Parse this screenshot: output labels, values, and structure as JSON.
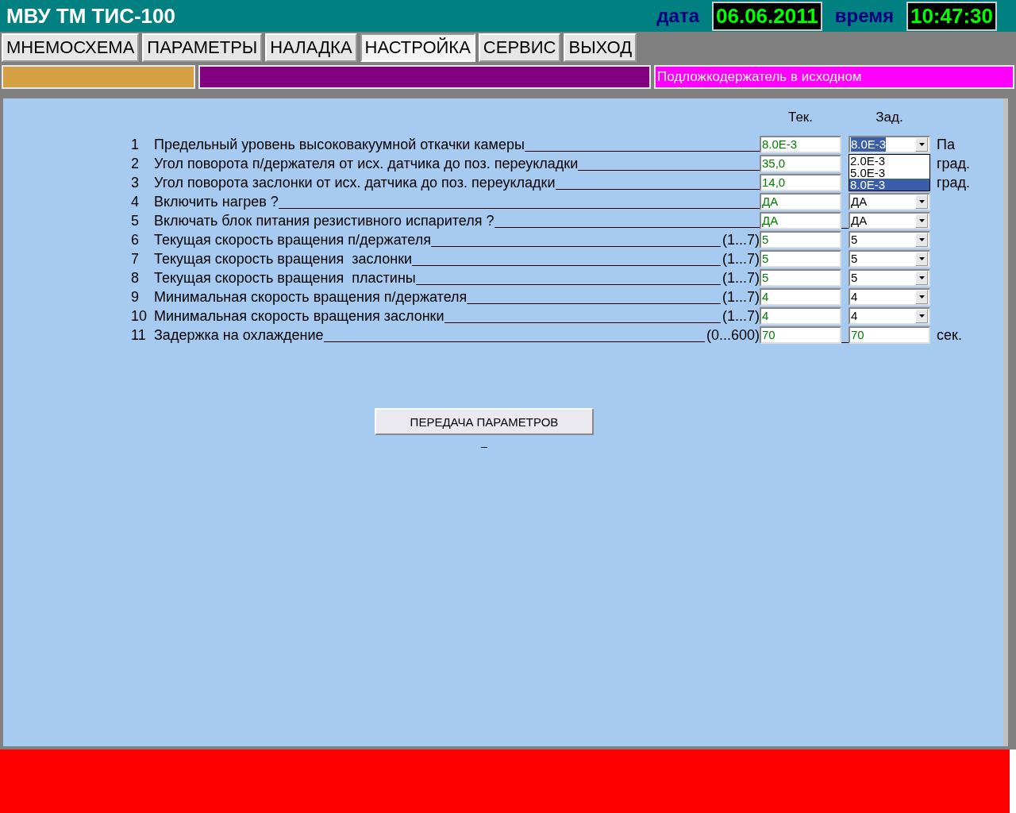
{
  "header": {
    "title": "МВУ ТМ ТИС-100",
    "date_label": "дата",
    "date": "06.06.2011",
    "time_label": "время",
    "time": "10:47:30"
  },
  "menu": [
    {
      "label": "МНЕМОСХЕМА",
      "selected": false
    },
    {
      "label": "ПАРАМЕТРЫ",
      "selected": false
    },
    {
      "label": "НАЛАДКА",
      "selected": false
    },
    {
      "label": "НАСТРОЙКА",
      "selected": true
    },
    {
      "label": "СЕРВИС",
      "selected": false
    },
    {
      "label": "ВЫХОД",
      "selected": false
    }
  ],
  "status": {
    "message": "Подложкодержатель в исходном"
  },
  "columns": {
    "current": "Тек.",
    "setpoint": "Зад."
  },
  "params": [
    {
      "num": "1",
      "label": "Предельный уровень высоковакуумной откачки камеры",
      "current": "8.0E-3",
      "set": {
        "kind": "select",
        "value": "8.0E-3",
        "options": [
          {
            "text": "2.0E-3",
            "selected": false
          },
          {
            "text": "5.0E-3",
            "selected": false
          },
          {
            "text": "8.0E-3",
            "selected": true
          }
        ]
      },
      "unit": "Па"
    },
    {
      "num": "2",
      "label": "Угол поворота п/держателя от исх. датчика до поз. переукладки",
      "current": "35,0",
      "unit": "град."
    },
    {
      "num": "3",
      "label": "Угол поворота заслонки от исх. датчика до поз. переукладки",
      "current": "14,0",
      "unit": "град."
    },
    {
      "num": "4",
      "label": "Включить нагрев ?",
      "current": "ДА",
      "set": {
        "kind": "select",
        "value": "ДА"
      }
    },
    {
      "num": "5",
      "label": "Включать блок питания резистивного испарителя ?",
      "current": "ДА",
      "set": {
        "kind": "select",
        "value": "ДА"
      }
    },
    {
      "num": "6",
      "label": "Текущая скорость вращения п/держателя",
      "range": "(1...7)",
      "current": "5",
      "set": {
        "kind": "select",
        "value": "5"
      }
    },
    {
      "num": "7",
      "label": "Текущая скорость вращения  заслонки",
      "range": "(1...7)",
      "current": "5",
      "set": {
        "kind": "select",
        "value": "5"
      }
    },
    {
      "num": "8",
      "label": "Текущая скорость вращения  пластины",
      "range": "(1...7)",
      "current": "5",
      "set": {
        "kind": "select",
        "value": "5"
      }
    },
    {
      "num": "9",
      "label": "Минимальная скорость вращения п/держателя",
      "range": "(1...7)",
      "current": "4",
      "set": {
        "kind": "select",
        "value": "4"
      }
    },
    {
      "num": "10",
      "label": "Минимальная скорость вращения заслонки",
      "range": "(1...7)",
      "current": "4",
      "set": {
        "kind": "select",
        "value": "4"
      }
    },
    {
      "num": "11",
      "label": "Задержка на охлаждение",
      "range": "(0...600)",
      "current": "70",
      "set": {
        "kind": "field",
        "value": "70"
      },
      "unit": "сек."
    }
  ],
  "send_button": {
    "label": "ПЕРЕДАЧА ПАРАМЕТРОВ"
  },
  "cursor_text": "_"
}
